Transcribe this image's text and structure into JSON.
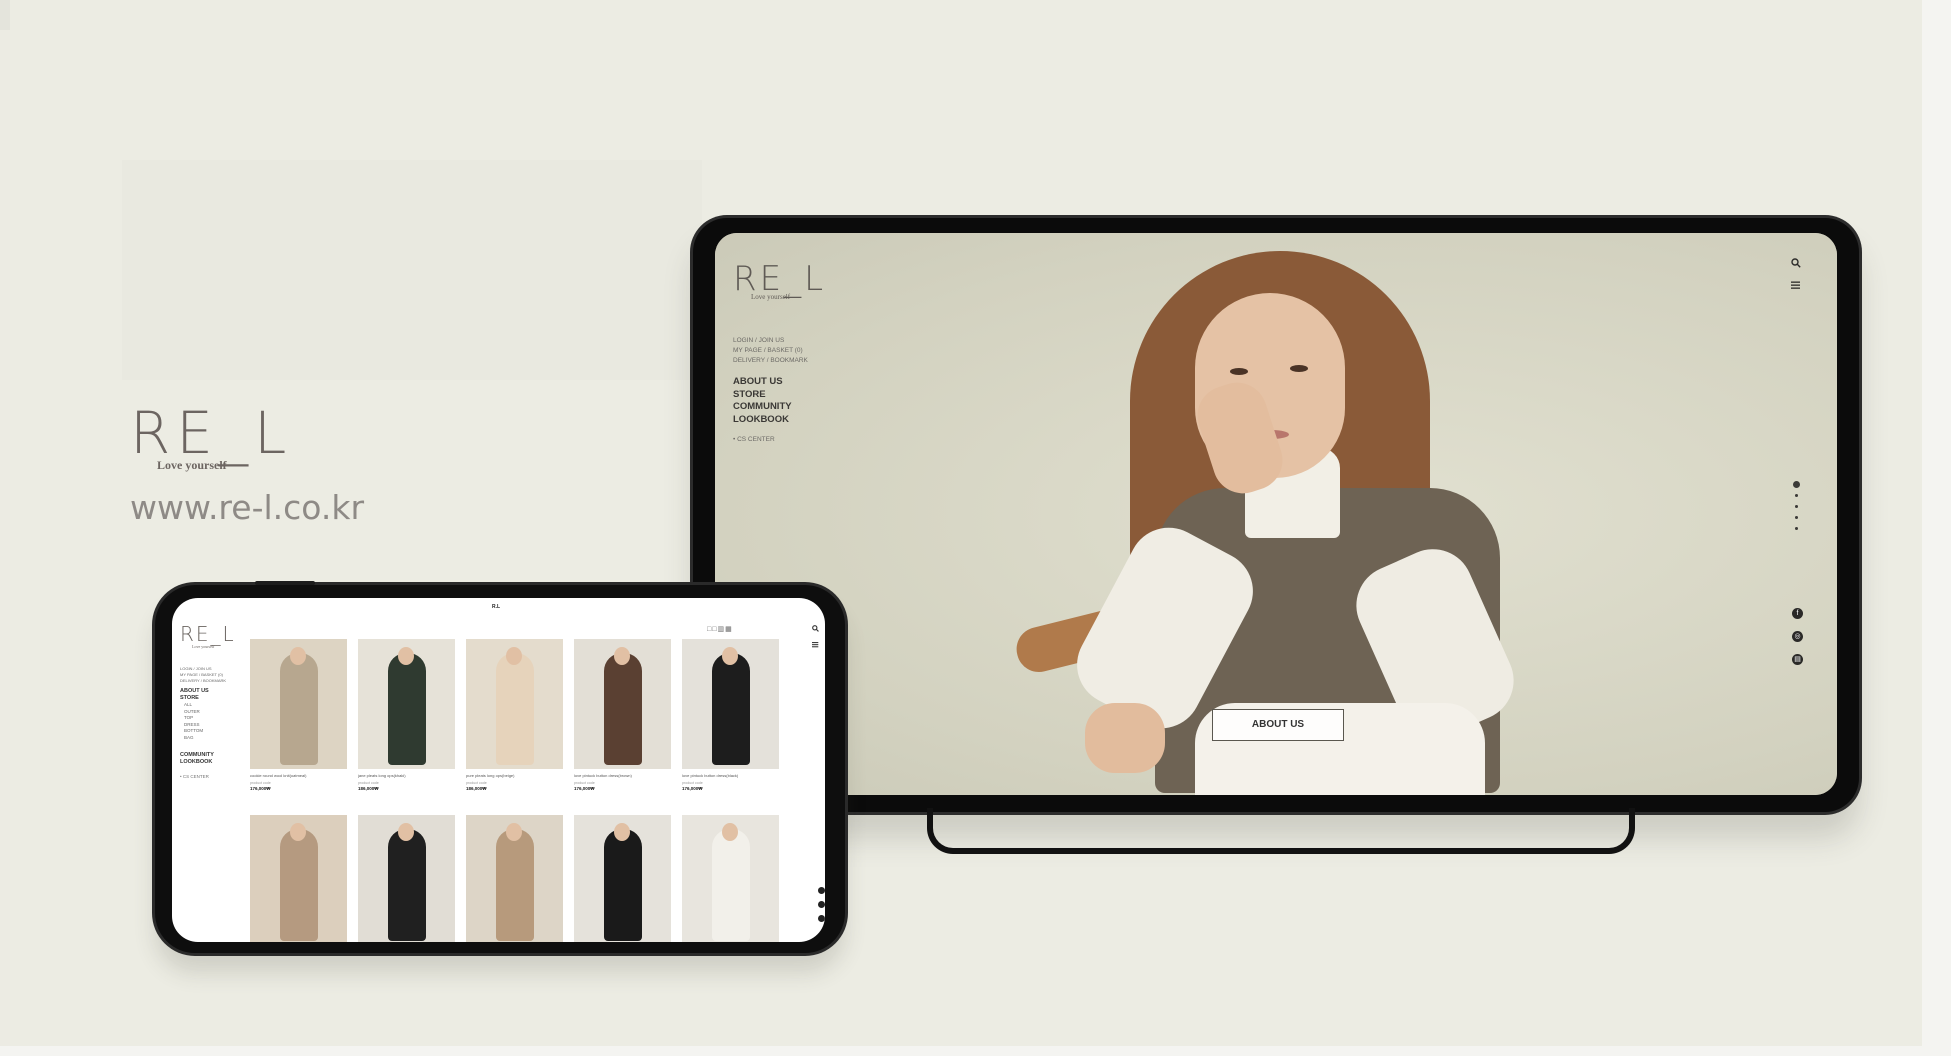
{
  "brand": {
    "logo": "RE_L",
    "tagline": "Love yourself",
    "url": "www.re-l.co.kr"
  },
  "hero": {
    "logo": "RE_L",
    "tagline": "Love yourself",
    "links": [
      "LOGIN / JOIN US",
      "MY PAGE / BASKET (0)",
      "DELIVERY / BOOKMARK"
    ],
    "menu": [
      "ABOUT US",
      "STORE",
      "COMMUNITY",
      "LOOKBOOK"
    ],
    "cs_center": "• CS CENTER",
    "about_button": "ABOUT US",
    "icons": {
      "search": "search-icon",
      "menu": "hamburger-icon"
    },
    "slider_count": 5,
    "social": [
      "facebook-icon",
      "instagram-icon",
      "blog-icon"
    ]
  },
  "shop": {
    "title": "R.L",
    "logo": "RE_L",
    "tagline": "Love yourself",
    "links": [
      "LOGIN / JOIN US",
      "MY PAGE / BASKET (0)",
      "DELIVERY / BOOKMARK"
    ],
    "menu": [
      "ABOUT US",
      "STORE"
    ],
    "submenu": [
      "ALL",
      "OUTER",
      "TOP",
      "DRESS",
      "BOTTOM",
      "BAG"
    ],
    "menu2": [
      "COMMUNITY",
      "LOOKBOOK"
    ],
    "cs_center": "• CS CENTER",
    "view_icons": "□□▥▦",
    "products": [
      {
        "name": "cookie round wool knit(oatmeal)",
        "code": "product code",
        "price": "176,000₩",
        "color": "#b7a78f",
        "bg": "#ddd4c3"
      },
      {
        "name": "jane pleats long ops(khaki)",
        "code": "product code",
        "price": "186,000₩",
        "color": "#2f3a30",
        "bg": "#e6e2d8"
      },
      {
        "name": "pure pleats long ops(beige)",
        "code": "product code",
        "price": "186,000₩",
        "color": "#e6d3bb",
        "bg": "#e4dccd"
      },
      {
        "name": "love pintuck button dress(brown)",
        "code": "product code",
        "price": "176,000₩",
        "color": "#5a4032",
        "bg": "#e3dfd6"
      },
      {
        "name": "love pintuck button dress(black)",
        "code": "product code",
        "price": "176,000₩",
        "color": "#1d1d1d",
        "bg": "#e4e1da"
      },
      {
        "name": "",
        "code": "",
        "price": "",
        "color": "#b59a80",
        "bg": "#dccfbd"
      },
      {
        "name": "",
        "code": "",
        "price": "",
        "color": "#202020",
        "bg": "#e1ddd5"
      },
      {
        "name": "",
        "code": "",
        "price": "",
        "color": "#b79a7c",
        "bg": "#ddd5c7"
      },
      {
        "name": "",
        "code": "",
        "price": "",
        "color": "#1a1a1a",
        "bg": "#e5e2db"
      },
      {
        "name": "",
        "code": "",
        "price": "",
        "color": "#f2f0ea",
        "bg": "#e8e5de"
      }
    ]
  }
}
